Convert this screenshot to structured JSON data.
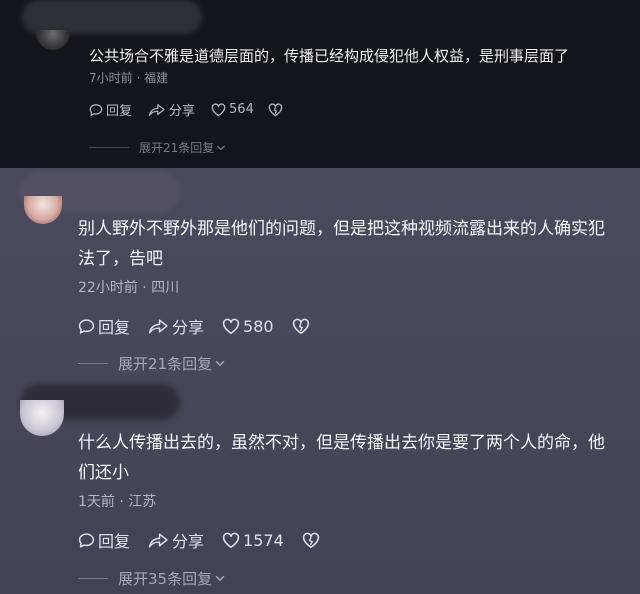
{
  "comments": [
    {
      "text": "公共场合不雅是道德层面的，传播已经构成侵犯他人权益，是刑事层面了",
      "meta": "7小时前 · 福建",
      "reply_label": "回复",
      "share_label": "分享",
      "like_count": "564",
      "expand_label": "展开21条回复"
    },
    {
      "text": "别人野外不野外那是他们的问题，但是把这种视频流露出来的人确实犯法了，告吧",
      "meta": "22小时前 · 四川",
      "reply_label": "回复",
      "share_label": "分享",
      "like_count": "580",
      "expand_label": "展开21条回复"
    },
    {
      "text": "什么人传播出去的，虽然不对，但是传播出去你是要了两个人的命，他们还小",
      "meta": "1天前 · 江苏",
      "reply_label": "回复",
      "share_label": "分享",
      "like_count": "1574",
      "expand_label": "展开35条回复"
    }
  ],
  "icons": {
    "reply": "reply-bubble-icon",
    "share": "share-arrow-icon",
    "like": "heart-icon",
    "dislike": "broken-heart-icon",
    "expand": "chevron-down-icon"
  }
}
